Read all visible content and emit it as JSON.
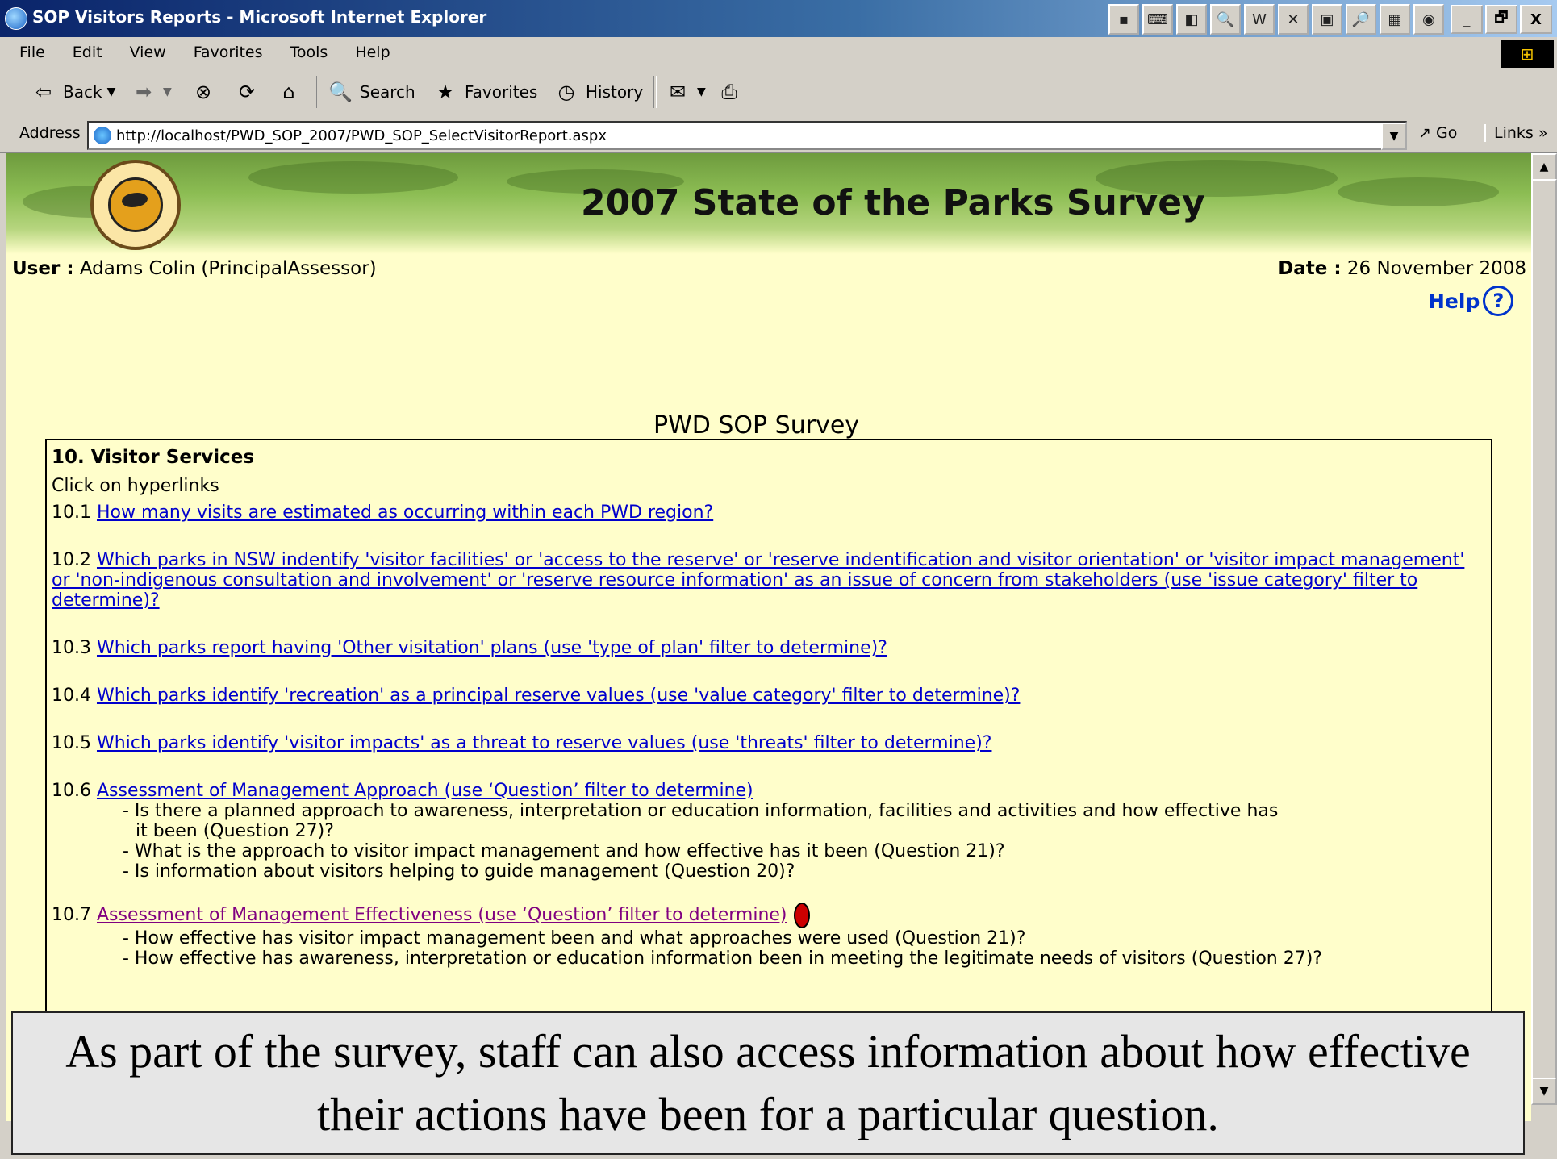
{
  "window": {
    "title": "SOP Visitors Reports - Microsoft Internet Explorer",
    "tray_icons": [
      "▪",
      "⌨",
      "◧",
      "🔍",
      "W",
      "✕",
      "▣",
      "🔎",
      "▦",
      "◉"
    ],
    "buttons": [
      "_",
      "🗗",
      "X"
    ]
  },
  "menu": {
    "items": [
      "File",
      "Edit",
      "View",
      "Favorites",
      "Tools",
      "Help"
    ]
  },
  "toolbar": {
    "back_label": "Back",
    "search_label": "Search",
    "favorites_label": "Favorites",
    "history_label": "History"
  },
  "address": {
    "label": "Address",
    "url": "http://localhost/PWD_SOP_2007/PWD_SOP_SelectVisitorReport.aspx",
    "go_label": "Go",
    "links_label": "Links »"
  },
  "page": {
    "banner_title": "2007 State of the Parks Survey",
    "user_label": "User :",
    "user_value": " Adams Colin (PrincipalAssessor)",
    "date_label": "Date :",
    "date_value": " 26 November 2008",
    "help_label": "Help",
    "help_icon": "?",
    "survey_title": "PWD SOP Survey",
    "section": {
      "heading": "10. Visitor Services",
      "instruction": "Click on hyperlinks",
      "questions": [
        {
          "num": "10.1 ",
          "text": "How many visits are estimated as occurring within each PWD region?"
        },
        {
          "num": "10.2 ",
          "text": "Which parks in NSW indentify 'visitor facilities' or 'access to the reserve' or 'reserve indentification and visitor orientation' or 'visitor impact management' or 'non-indigenous consultation and involvement' or 'reserve resource information' as an issue of concern from stakeholders (use 'issue category' filter to determine)?"
        },
        {
          "num": "10.3 ",
          "text": "Which parks report having 'Other visitation' plans (use 'type of plan' filter to determine)?"
        },
        {
          "num": "10.4 ",
          "text": "Which parks identify 'recreation' as a principal reserve values (use 'value category' filter to determine)?"
        },
        {
          "num": "10.5 ",
          "text": "Which parks identify 'visitor impacts' as a threat to reserve values (use 'threats' filter to determine)?"
        },
        {
          "num": "10.6 ",
          "text": "Assessment of Management Approach (use ‘Question’ filter to determine)",
          "subs": [
            "- Is there a planned approach to awareness, interpretation or education information, facilities and activities and how effective has",
            "it been (Question 27)?",
            "- What is the approach to visitor impact management and how effective has it been (Question 21)?",
            "- Is information about visitors helping to guide management (Question 20)?"
          ]
        },
        {
          "num": "10.7 ",
          "text": "Assessment of Management Effectiveness (use ‘Question’ filter to determine)",
          "subs": [
            "- How effective has visitor impact management been and what approaches were used (Question 21)?",
            "- How effective has awareness, interpretation or education information been in meeting the legitimate needs of visitors (Question 27)?"
          ]
        }
      ]
    }
  },
  "caption": "As part of the survey, staff can also access information about how effective their actions have been for a particular question."
}
